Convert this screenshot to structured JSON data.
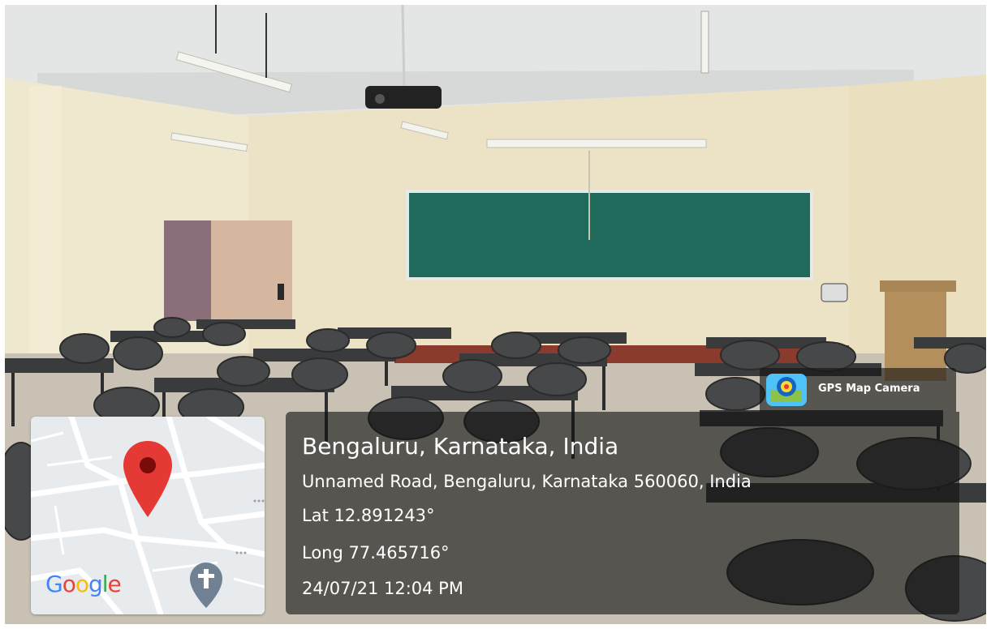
{
  "overlay": {
    "app_name": "GPS Map Camera",
    "app_icon": "gps-camera-lens-icon",
    "location_title": "Bengaluru, Karnataka, India",
    "address": "Unnamed Road, Bengaluru, Karnataka 560060, India",
    "latitude": "Lat 12.891243°",
    "longitude": "Long 77.465716°",
    "datetime": "24/07/21 12:04 PM"
  },
  "map": {
    "brand": "Google",
    "pin_icon": "map-pin-icon",
    "poi_icon": "church-cross-icon",
    "colors": {
      "pin": "#e53935",
      "google_blue": "#4285f4",
      "google_red": "#ea4335",
      "google_yellow": "#fbbc05",
      "google_green": "#34a853"
    }
  },
  "colors": {
    "chalkboard": "#1f6a5a",
    "wall": "#ece4c8",
    "overlay_panel": "rgba(18,18,18,0.62)"
  }
}
